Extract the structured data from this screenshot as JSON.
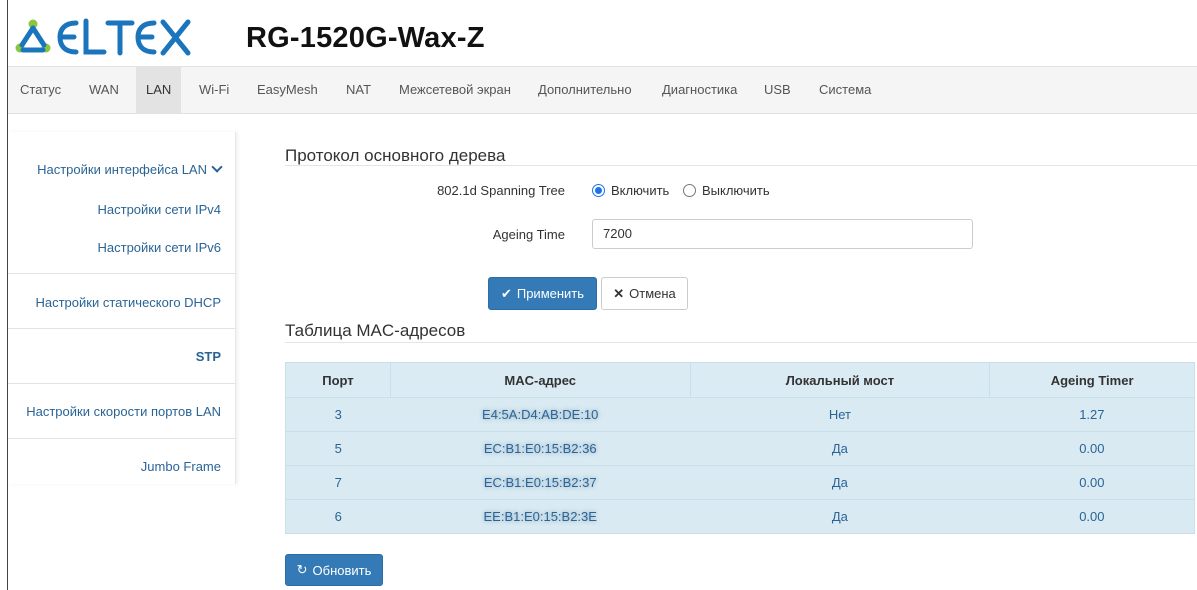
{
  "header": {
    "logo_text": "ELTEX",
    "device_title": "RG-1520G-Wax-Z"
  },
  "topnav": {
    "items": [
      {
        "label": "Статус"
      },
      {
        "label": "WAN"
      },
      {
        "label": "LAN",
        "active": true
      },
      {
        "label": "Wi-Fi"
      },
      {
        "label": "EasyMesh"
      },
      {
        "label": "NAT"
      },
      {
        "label": "Межсетевой экран"
      },
      {
        "label": "Дополнительно"
      },
      {
        "label": "Диагностика"
      },
      {
        "label": "USB"
      },
      {
        "label": "Система"
      }
    ]
  },
  "sidebar": {
    "items": [
      {
        "label": "Настройки интерфейса LAN"
      },
      {
        "label": "Настройки сети IPv4"
      },
      {
        "label": "Настройки сети IPv6"
      },
      {
        "label": "Настройки статического DHCP"
      },
      {
        "label": "STP",
        "current": true
      },
      {
        "label": "Настройки скорости портов LAN"
      },
      {
        "label": "Jumbo Frame"
      }
    ]
  },
  "stp": {
    "section_title": "Протокол основного дерева",
    "spanning_tree_label": "802.1d Spanning Tree",
    "enable_label": "Включить",
    "disable_label": "Выключить",
    "selected": "enable",
    "ageing_time_label": "Ageing Time",
    "ageing_time_value": "7200",
    "apply_label": "Применить",
    "cancel_label": "Отмена"
  },
  "mac_table": {
    "section_title": "Таблица MAC-адресов",
    "columns": [
      "Порт",
      "MAC-адрес",
      "Локальный мост",
      "Ageing Timer"
    ],
    "rows": [
      {
        "port": "3",
        "mac": "E4:5A:D4:AB:DE:10",
        "local": "Нет",
        "timer": "1.27"
      },
      {
        "port": "5",
        "mac": "EC:B1:E0:15:B2:36",
        "local": "Да",
        "timer": "0.00"
      },
      {
        "port": "7",
        "mac": "EC:B1:E0:15:B2:37",
        "local": "Да",
        "timer": "0.00"
      },
      {
        "port": "6",
        "mac": "EE:B1:E0:15:B2:3E",
        "local": "Да",
        "timer": "0.00"
      }
    ],
    "refresh_label": "Обновить"
  },
  "colors": {
    "brand": "#1b75bc",
    "logo_accent_green": "#8cc63f",
    "primary_button": "#337ab7",
    "table_row": "#d9eaf2",
    "link": "#2a6496"
  }
}
